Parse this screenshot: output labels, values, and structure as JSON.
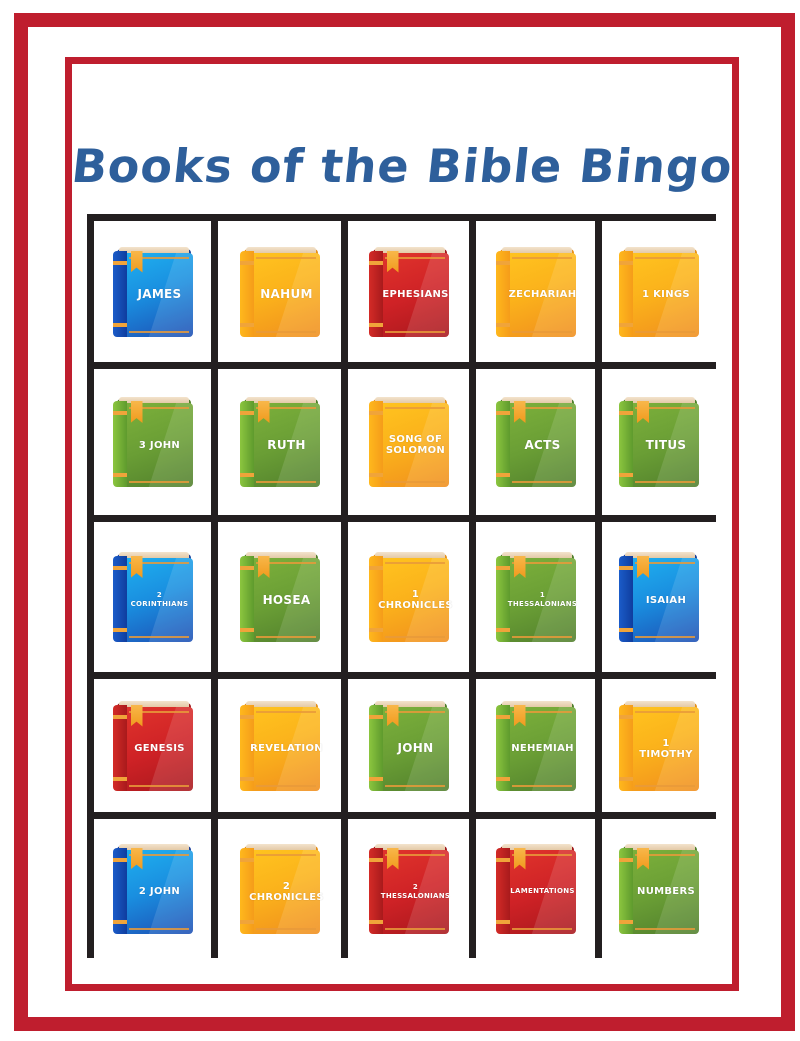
{
  "title": "Books of the Bible Bingo",
  "colors": {
    "frame_red": "#bf1e2e",
    "title_blue": "#2e5f9b",
    "grid_black": "#231f20",
    "book_blue": "#1a8fe0",
    "book_orange": "#fbb21b",
    "book_red": "#cf2226",
    "book_green": "#6a9e35"
  },
  "card": {
    "rows": [
      [
        {
          "label": "James",
          "color": "blue",
          "bookmark": true
        },
        {
          "label": "Nahum",
          "color": "orange",
          "bookmark": false
        },
        {
          "label": "Ephesians",
          "color": "red",
          "bookmark": true
        },
        {
          "label": "Zechariah",
          "color": "orange",
          "bookmark": false
        },
        {
          "label": "1 Kings",
          "color": "orange",
          "bookmark": false
        }
      ],
      [
        {
          "label": "3 John",
          "color": "green",
          "bookmark": true
        },
        {
          "label": "Ruth",
          "color": "green",
          "bookmark": true
        },
        {
          "label": "Song of Solomon",
          "color": "orange",
          "bookmark": false
        },
        {
          "label": "Acts",
          "color": "green",
          "bookmark": true
        },
        {
          "label": "Titus",
          "color": "green",
          "bookmark": true
        }
      ],
      [
        {
          "label": "2 Corinthians",
          "color": "blue",
          "bookmark": true
        },
        {
          "label": "Hosea",
          "color": "green",
          "bookmark": true
        },
        {
          "label": "1 Chronicles",
          "color": "orange",
          "bookmark": false
        },
        {
          "label": "1 Thessalonians",
          "color": "green",
          "bookmark": true
        },
        {
          "label": "Isaiah",
          "color": "blue",
          "bookmark": true
        }
      ],
      [
        {
          "label": "Genesis",
          "color": "red",
          "bookmark": true
        },
        {
          "label": "Revelation",
          "color": "orange",
          "bookmark": false
        },
        {
          "label": "John",
          "color": "green",
          "bookmark": true
        },
        {
          "label": "Nehemiah",
          "color": "green",
          "bookmark": true
        },
        {
          "label": "1 Timothy",
          "color": "orange",
          "bookmark": false
        }
      ],
      [
        {
          "label": "2 John",
          "color": "blue",
          "bookmark": true
        },
        {
          "label": "2 Chronicles",
          "color": "orange",
          "bookmark": false
        },
        {
          "label": "2 Thessalonians",
          "color": "red",
          "bookmark": true
        },
        {
          "label": "Lamentations",
          "color": "red",
          "bookmark": true
        },
        {
          "label": "Numbers",
          "color": "green",
          "bookmark": true
        }
      ]
    ]
  }
}
